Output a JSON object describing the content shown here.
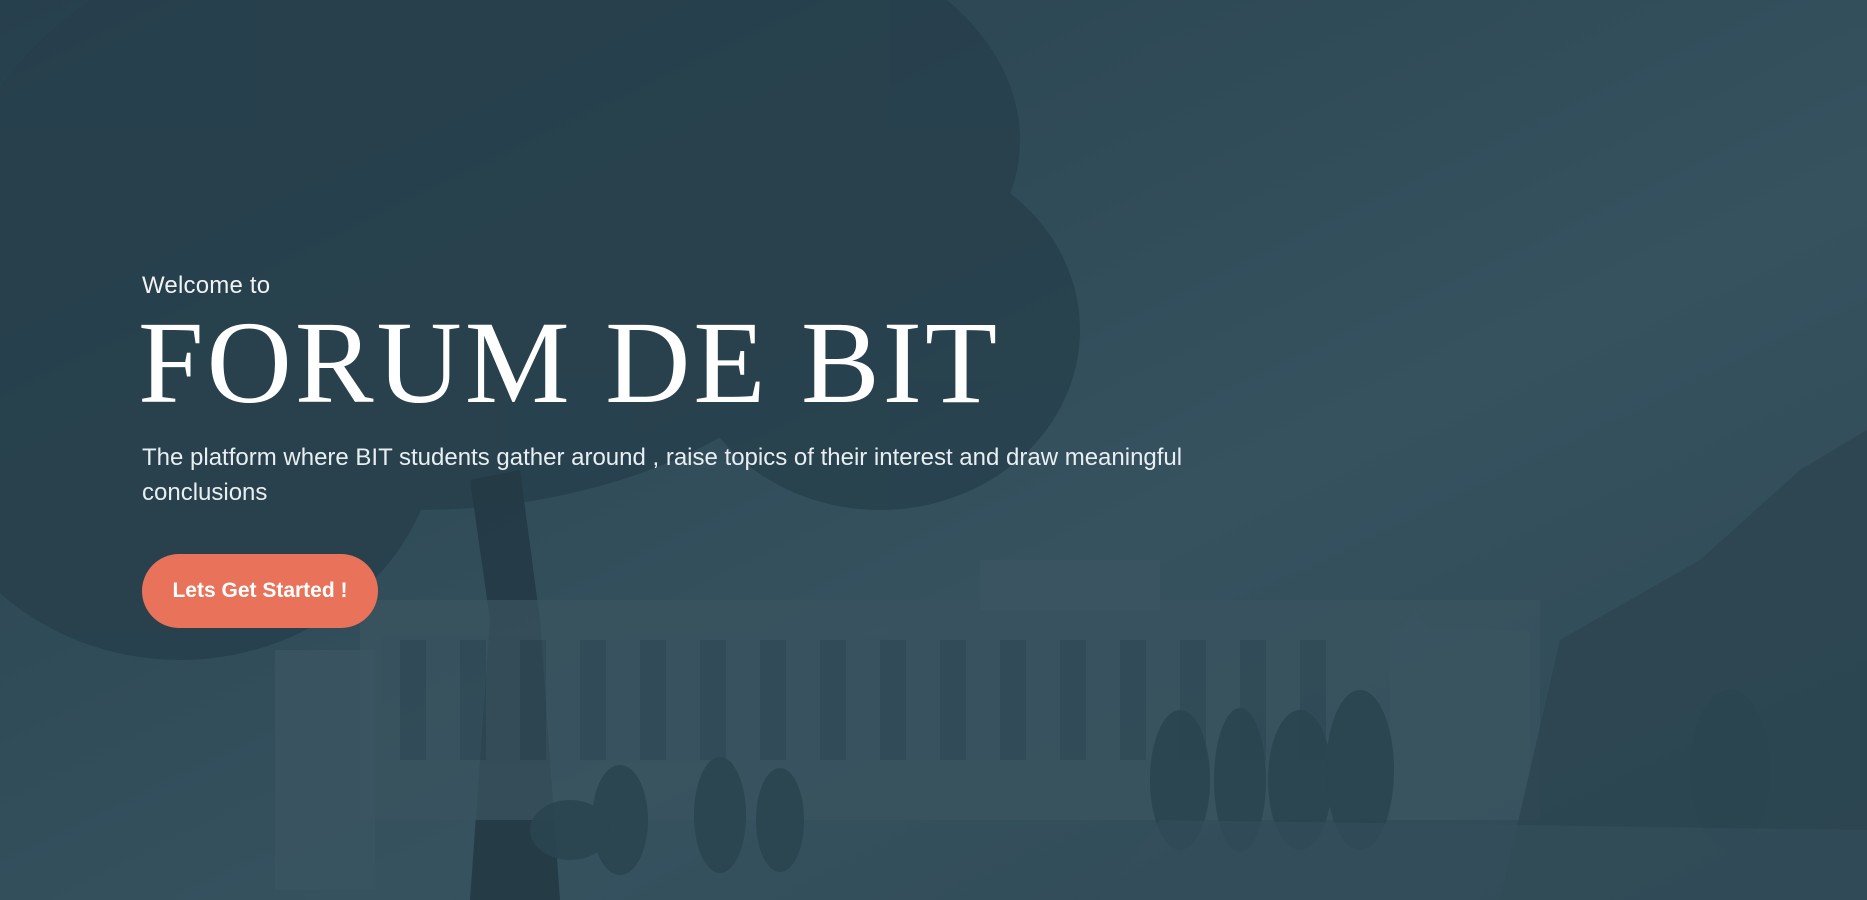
{
  "hero": {
    "welcome": "Welcome to",
    "title": "FORUM DE BIT",
    "tagline": "The platform where BIT students gather around , raise topics of their interest and draw meaningful conclusions",
    "cta_label": "Lets Get Started !"
  },
  "colors": {
    "overlay": "#2f4a58",
    "accent": "#e8735a",
    "text": "#ffffff"
  }
}
